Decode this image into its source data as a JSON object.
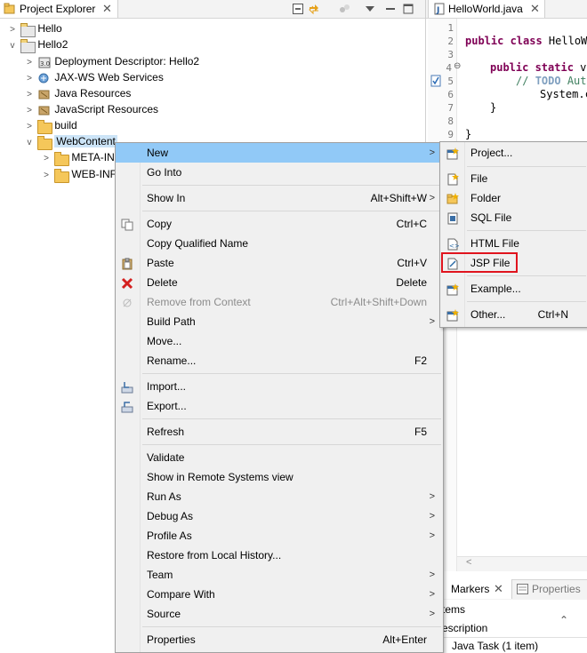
{
  "project_explorer": {
    "title": "Project Explorer",
    "tree": [
      {
        "label": "Hello",
        "twisty": ">"
      },
      {
        "label": "Hello2",
        "twisty": "v"
      },
      {
        "label": "Deployment Descriptor: Hello2",
        "twisty": ">"
      },
      {
        "label": "JAX-WS Web Services",
        "twisty": ">"
      },
      {
        "label": "Java Resources",
        "twisty": ">"
      },
      {
        "label": "JavaScript Resources",
        "twisty": ">"
      },
      {
        "label": "build",
        "twisty": ">"
      },
      {
        "label": "WebContent",
        "twisty": "v"
      },
      {
        "label": "META-IN",
        "twisty": ">"
      },
      {
        "label": "WEB-INF",
        "twisty": ">"
      }
    ]
  },
  "editor": {
    "tab_title": "HelloWorld.java",
    "line_numbers": [
      "1",
      "2",
      "3",
      "4",
      "5",
      "6",
      "7",
      "8",
      "9"
    ],
    "line4_marker": "⊖",
    "code": {
      "l2_kw": "public class",
      "l2_rest": " HelloWo",
      "l4_kw": "public static",
      "l4_rest": " vo",
      "l5_comment": "// ",
      "l5_todo": "TODO",
      "l5_rest": " Auto",
      "l6": "System.c",
      "l7": "}",
      "l9": "}"
    }
  },
  "bottom_panel": {
    "markers_tab": "Markers",
    "properties_tab": "Properties",
    "items_text": "tems",
    "description_header": "escription",
    "task_row": "Java Task (1 item)",
    "scroll_arrow": "<"
  },
  "context_menu": {
    "items": [
      {
        "label": "New",
        "shortcut": "",
        "submenu": true
      },
      {
        "label": "Go Into",
        "shortcut": ""
      },
      {
        "label": "Show In",
        "shortcut": "Alt+Shift+W",
        "submenu": true
      },
      {
        "label": "Copy",
        "shortcut": "Ctrl+C"
      },
      {
        "label": "Copy Qualified Name",
        "shortcut": ""
      },
      {
        "label": "Paste",
        "shortcut": "Ctrl+V"
      },
      {
        "label": "Delete",
        "shortcut": "Delete"
      },
      {
        "label": "Remove from Context",
        "shortcut": "Ctrl+Alt+Shift+Down"
      },
      {
        "label": "Build Path",
        "shortcut": "",
        "submenu": true
      },
      {
        "label": "Move...",
        "shortcut": ""
      },
      {
        "label": "Rename...",
        "shortcut": "F2"
      },
      {
        "label": "Import...",
        "shortcut": ""
      },
      {
        "label": "Export...",
        "shortcut": ""
      },
      {
        "label": "Refresh",
        "shortcut": "F5"
      },
      {
        "label": "Validate",
        "shortcut": ""
      },
      {
        "label": "Show in Remote Systems view",
        "shortcut": ""
      },
      {
        "label": "Run As",
        "shortcut": "",
        "submenu": true
      },
      {
        "label": "Debug As",
        "shortcut": "",
        "submenu": true
      },
      {
        "label": "Profile As",
        "shortcut": "",
        "submenu": true
      },
      {
        "label": "Restore from Local History...",
        "shortcut": ""
      },
      {
        "label": "Team",
        "shortcut": "",
        "submenu": true
      },
      {
        "label": "Compare With",
        "shortcut": "",
        "submenu": true
      },
      {
        "label": "Source",
        "shortcut": "",
        "submenu": true
      },
      {
        "label": "Properties",
        "shortcut": "Alt+Enter"
      }
    ],
    "arrow": ">"
  },
  "new_submenu": {
    "items": [
      {
        "label": "Project...",
        "shortcut": ""
      },
      {
        "label": "File",
        "shortcut": ""
      },
      {
        "label": "Folder",
        "shortcut": ""
      },
      {
        "label": "SQL File",
        "shortcut": ""
      },
      {
        "label": "HTML File",
        "shortcut": ""
      },
      {
        "label": "JSP File",
        "shortcut": ""
      },
      {
        "label": "Example...",
        "shortcut": ""
      },
      {
        "label": "Other...",
        "shortcut": "Ctrl+N"
      }
    ]
  },
  "colors": {
    "menu_highlight": "#91c9f7",
    "tree_selection": "#cce4f7",
    "callout_red": "#e0141e"
  }
}
